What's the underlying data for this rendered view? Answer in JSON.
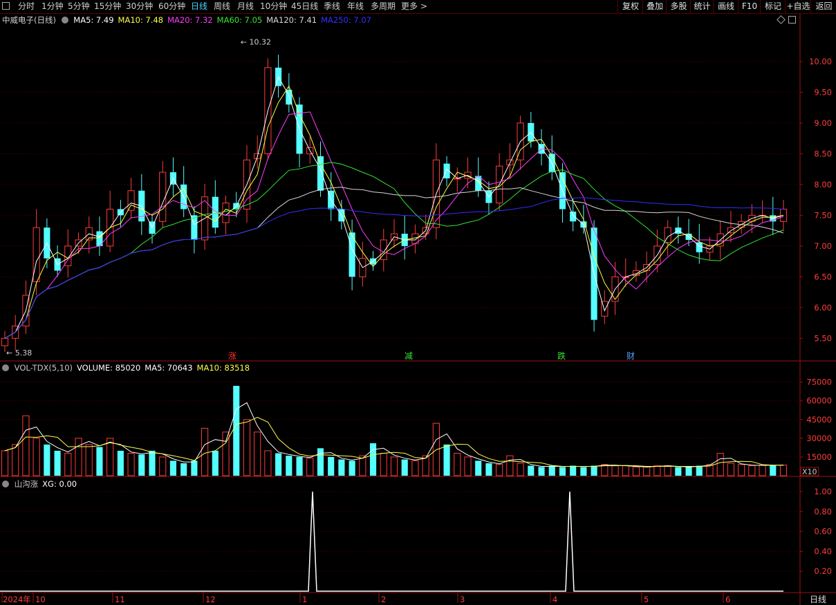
{
  "toolbar": {
    "left_icon": "panel-toggle-icon",
    "periods": [
      "分时",
      "1分钟",
      "5分钟",
      "15分钟",
      "30分钟",
      "60分钟",
      "日线",
      "周线",
      "月线",
      "10分钟",
      "45日线",
      "季线",
      "年线",
      "多周期",
      "更多 >"
    ],
    "active_period": "日线",
    "right_buttons": [
      "复权",
      "叠加",
      "多股",
      "统计",
      "画线",
      "F10",
      "标记",
      "+自选",
      "返回"
    ]
  },
  "main": {
    "stock_name": "中威电子(日线)",
    "ma": [
      {
        "label": "MA5: 7.49",
        "color": "#ffffff"
      },
      {
        "label": "MA10: 7.48",
        "color": "#ffff4a"
      },
      {
        "label": "MA20: 7.32",
        "color": "#ff3dff"
      },
      {
        "label": "MA60: 7.05",
        "color": "#33e633"
      },
      {
        "label": "MA120: 7.41",
        "color": "#d8d8d8"
      },
      {
        "label": "MA250: 7.07",
        "color": "#3030ff"
      }
    ],
    "price_ticks": [
      "10.00",
      "9.50",
      "9.00",
      "8.50",
      "8.00",
      "7.50",
      "7.00",
      "6.50",
      "6.00",
      "5.50"
    ],
    "high_label": "10.32",
    "low_label": "5.38",
    "markers": [
      {
        "text": "涨",
        "color": "#ff3030"
      },
      {
        "text": "减",
        "color": "#33e633"
      },
      {
        "text": "跌",
        "color": "#33e633"
      },
      {
        "text": "财",
        "color": "#4fa3ff"
      }
    ]
  },
  "volume": {
    "legend": [
      {
        "label": "VOL-TDX(5,10)",
        "color": "#c8c8c8"
      },
      {
        "label": "VOLUME: 85020",
        "color": "#ffffff"
      },
      {
        "label": "MA5: 70643",
        "color": "#ffffff"
      },
      {
        "label": "MA10: 83518",
        "color": "#ffff4a"
      }
    ],
    "ticks": [
      "75000",
      "60000",
      "45000",
      "30000",
      "15000"
    ],
    "unit": "X10"
  },
  "indicator": {
    "legend": [
      {
        "label": "山沟涨",
        "color": "#c8c8c8"
      },
      {
        "label": "XG: 0.00",
        "color": "#ffffff"
      }
    ],
    "ticks": [
      "1.00",
      "0.80",
      "0.60",
      "0.40",
      "0.20"
    ]
  },
  "date_axis": {
    "labels": [
      "2024年",
      "10",
      "11",
      "12",
      "1",
      "2",
      "3",
      "4",
      "5",
      "6"
    ],
    "period_label": "日线"
  },
  "chart_data": {
    "type": "candlestick",
    "series_start_month": "2024年10",
    "price_range": [
      5.38,
      10.32
    ],
    "moving_averages": [
      "MA5",
      "MA10",
      "MA20",
      "MA60",
      "MA120",
      "MA250"
    ],
    "close_levels": [
      5.5,
      5.7,
      6.2,
      7.3,
      6.8,
      6.6,
      7.0,
      7.1,
      7.3,
      7.0,
      7.6,
      7.5,
      7.9,
      7.4,
      7.2,
      8.2,
      8.0,
      7.6,
      7.1,
      7.8,
      7.3,
      7.7,
      7.6,
      8.4,
      8.5,
      9.9,
      9.6,
      9.3,
      8.5,
      8.6,
      7.9,
      7.6,
      7.4,
      6.5,
      6.8,
      6.7,
      7.1,
      7.2,
      7.0,
      7.2,
      7.3,
      8.4,
      8.1,
      8.1,
      8.2,
      7.9,
      7.7,
      8.3,
      8.4,
      9.0,
      8.7,
      8.5,
      8.2,
      7.6,
      7.4,
      7.3,
      5.8,
      6.1,
      6.5,
      6.5,
      6.6,
      6.7,
      7.0,
      7.3,
      7.2,
      7.1,
      6.9,
      7.0,
      7.2,
      7.3,
      7.4,
      7.5,
      7.5,
      7.4,
      7.6
    ],
    "volume_range": [
      0,
      75000
    ],
    "volume_levels": [
      20000,
      25000,
      48000,
      30000,
      25000,
      20000,
      18000,
      30000,
      25000,
      23000,
      30000,
      20000,
      18000,
      17000,
      20000,
      15000,
      12000,
      10000,
      12000,
      38000,
      20000,
      35000,
      72000,
      45000,
      35000,
      20000,
      18000,
      16000,
      15000,
      14000,
      22000,
      15000,
      13000,
      12000,
      16000,
      26000,
      18000,
      15000,
      13000,
      12000,
      16000,
      42000,
      25000,
      18000,
      15000,
      12000,
      10000,
      9000,
      16000,
      10000,
      8000,
      7000,
      8000,
      7000,
      8000,
      7000,
      8000,
      9000,
      8000,
      8000,
      7000,
      7000,
      8000,
      8000,
      7000,
      7000,
      8000,
      9000,
      18000,
      10000,
      9000,
      8000,
      8500,
      8500,
      8500
    ],
    "xg_signal_range": [
      0,
      1
    ],
    "xg_signals": [
      {
        "month": "1",
        "value": 1.0
      },
      {
        "month": "4",
        "value": 1.0
      }
    ]
  }
}
